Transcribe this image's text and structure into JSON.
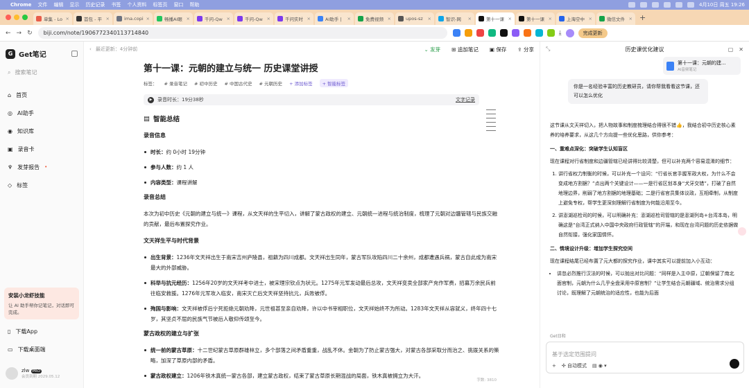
{
  "menubar": {
    "app": "Chrome",
    "items": [
      "文件",
      "编辑",
      "显示",
      "历史记录",
      "书签",
      "个人资料",
      "标签页",
      "窗口",
      "帮助"
    ],
    "clock": "4月10日 周五 19:26"
  },
  "tabs": [
    {
      "label": "单集 - Lo",
      "color": "#e85d4a"
    },
    {
      "label": "首包 - 平",
      "color": "#333"
    },
    {
      "label": "ima.copi",
      "color": "#6b7280"
    },
    {
      "label": "畅播AI眼",
      "color": "#22c55e"
    },
    {
      "label": "千问-Qw",
      "color": "#7c3aed"
    },
    {
      "label": "千问-Qw",
      "color": "#7c3aed"
    },
    {
      "label": "千问实时",
      "color": "#7c3aed"
    },
    {
      "label": "AI助手 |",
      "color": "#3b82f6"
    },
    {
      "label": "免费视频",
      "color": "#16a34a"
    },
    {
      "label": "upos-sz",
      "color": "#555"
    },
    {
      "label": "智识-网",
      "color": "#0ea5e9"
    },
    {
      "label": "第十一课",
      "color": "#111",
      "active": true
    },
    {
      "label": "第十一课",
      "color": "#111"
    },
    {
      "label": "上海空中",
      "color": "#2563eb"
    },
    {
      "label": "微信文件",
      "color": "#16a34a"
    }
  ],
  "address": {
    "url": "biji.com/note/1906772340113714840",
    "complete_btn": "完成更新"
  },
  "sidebar": {
    "app_name": "Get笔记",
    "search_placeholder": "搜索笔记",
    "items": [
      {
        "label": "首页",
        "icon": "home-icon"
      },
      {
        "label": "AI助手",
        "icon": "ai-icon"
      },
      {
        "label": "知识库",
        "icon": "knowledge-icon"
      },
      {
        "label": "录音卡",
        "icon": "card-icon"
      },
      {
        "label": "发芽报告",
        "icon": "sprout-icon",
        "dot": "•"
      },
      {
        "label": "标签",
        "icon": "tag-icon"
      }
    ],
    "promo_title": "安装小龙虾技能",
    "promo_text": "让 AI 助手帮你记笔记，对话即可完成。",
    "download_app": "下载App",
    "download_desktop": "下载桌面端",
    "user_name": "zlw",
    "user_badge": "PRO",
    "user_sub": "会员到期 2029.05.12"
  },
  "toolbar": {
    "last_update": "最近更新：4分钟前",
    "sprout": "发芽",
    "add_note": "追加笔记",
    "save": "保存",
    "share": "分享"
  },
  "note": {
    "title": "第十一课：元朝的建立与统一 历史课堂讲授",
    "tag_label": "标签：",
    "tags": [
      "录音笔记",
      "初中历史",
      "中国古代史",
      "元朝历史"
    ],
    "add_tag": "+ 添加标签",
    "smart_tag": "+ 智能标签",
    "rec_duration": "录音时长：19分38秒",
    "rec_link": "文字记录",
    "summary_title": "智能总结",
    "info_title": "录音信息",
    "info_items": [
      {
        "k": "时长：",
        "v": "约 0小时 19分钟"
      },
      {
        "k": "参与人数：",
        "v": "约 1 人"
      },
      {
        "k": "内容类型：",
        "v": "课程讲解"
      }
    ],
    "sum_title": "录音总结",
    "sum_text": "本次为初中历史《元朝的建立与统一》课程，从文天祥的生平切入，讲解了蒙古政权的建立、元朝统一进程与统治制度，梳理了元朝对边疆管辖与民族交融的贡献，最后布置探究作业。",
    "sec1_title": "文天祥生平与时代背景",
    "sec1_items": [
      {
        "k": "出生背景：",
        "v": "1236年文天祥出生于南宋吉州庐陵县，祖籍为四川成都。文天祥出生同年，蒙古军队攻陷四川二十余州，成都遭遇兵祸，蒙古自此成为南宋最大的外部威胁。"
      },
      {
        "k": "科举与抗元经历：",
        "v": "1256年20岁的文天祥考中进士，被宋理宗钦点为状元。1275年元军发动最后总攻，文天祥变卖全部家产充作军费，招募万余民兵前往临安救援。1276年元军攻入临安，南宋灭亡后文天祥坚持抗元，兵败被俘。"
      },
      {
        "k": "殉国与影响：",
        "v": "文天祥被俘后宁死拒绝元朝劝降，元世祖甚至亲自劝降，许以中书宰相职位，文天祥始终不为所动。1283年文天祥从容就义，终年四十七岁，其坚贞不屈的民族气节被后人敬仰传颂至今。"
      }
    ],
    "sec2_title": "蒙古政权的建立与扩张",
    "sec2_items": [
      {
        "k": "统一前的蒙古草原：",
        "v": "十二世纪蒙古草原群雄林立，多个部落之间矛盾重重，战乱不休。金朝为了防止蒙古强大，对蒙古各部采取分而治之、挑拨关系的策略，加深了草原内部的矛盾。"
      },
      {
        "k": "蒙古政权建立：",
        "v": "1206年铁木真统一蒙古各部，建立蒙古政权，结束了蒙古草原长期混战的局面，铁木真被拥立为大汗。"
      }
    ],
    "word_count": "字数: 3810"
  },
  "panel": {
    "title": "历史课优化建议",
    "doc_title": "第十一课：元朝的建...",
    "doc_sub": "AI音频笔记",
    "user_msg": "你是一名经验丰富的历史教研员，请你帮我看看这节课，还可以怎么优化",
    "intro": "这节课从文天祥切入，把人物故事和制度梳理结合得很不错👍，我结合初中历史核心素养的培养要求，从这几个方向提一些优化思路，供你参考：",
    "h1": "一、重难点深化：突破学生认知盲区",
    "p1": "现在课程对行省制度和边疆管辖已经讲得比较清楚，但可以补充两个容易混淆的细节：",
    "ol1": [
      "讲行省权力制衡的时候，可以补充一个设问：“行省长官手握军政大权，为什么不会变成地方割据？”点出两个关键设计——一是行省区划本身“犬牙交错”，打破了自然地理边界，削弱了地方割据的地理基础；二是行省官员集体议政，互相牵制，从制度上避免专权，帮学生更深刻理解行省制度为何能沿用至今。",
      "讲澎湖巡检司的时候，可以明确补充：澎湖巡检司管辖的是澎湖列岛+台湾本岛，明确这是“台湾正式纳入中国中央政府行政管辖”的开端，和现在台湾问题的历史依据做自然衔接，强化家国情怀。"
    ],
    "h2": "二、情境设计升级：增加学生探究空间",
    "p2": "现在课程结尾已经布置了元大都的探究作业，课中其实可以提前加入小互动：",
    "ul2": [
      "讲忽必烈推行汉法的时候，可以抛出对比问题：“同样是入主中原，辽朝保留了南北面官制，元朝为什么几乎全盘采用中原官制？”让学生结合元朝疆域、统治需求分组讨论，既理解了元朝统治的适应性，也能为后面"
    ],
    "get_label": "Get日和",
    "input_placeholder": "基于选定范围提问",
    "auto_mode": "自动模式",
    "plus": "+"
  }
}
